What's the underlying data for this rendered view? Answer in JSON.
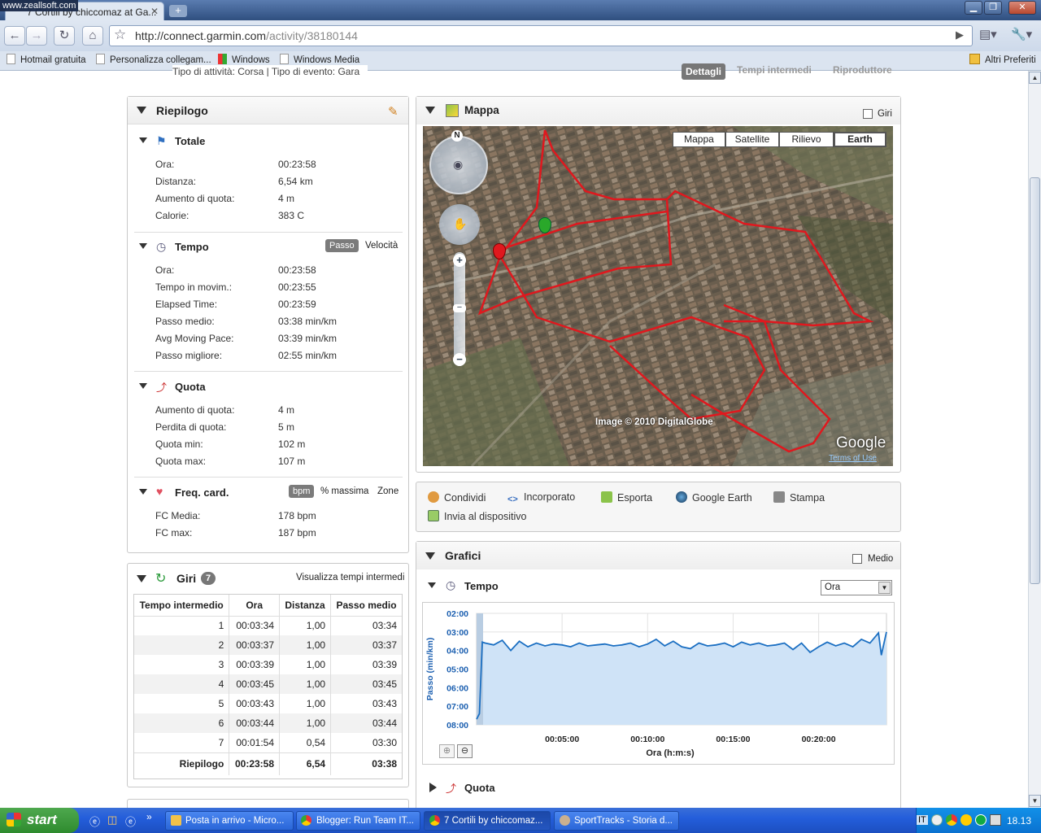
{
  "browser": {
    "watermark": "www.zeallsoft.com",
    "tab_title": "7 Cortili by chiccomaz at Ga...",
    "url_host": "http://connect.garmin.com",
    "url_path": "/activity/38180144",
    "bookmarks": [
      "Hotmail gratuita",
      "Personalizza collegam...",
      "Windows",
      "Windows Media"
    ],
    "other_bookmarks": "Altri Preferiti"
  },
  "page": {
    "top_info": "Tipo di attività: Corsa | Tipo di evento: Gara",
    "view_tabs": [
      "Dettagli",
      "Tempi intermedi",
      "Riproduttore"
    ]
  },
  "summary": {
    "title": "Riepilogo",
    "totale": {
      "title": "Totale",
      "rows": [
        {
          "label": "Ora:",
          "value": "00:23:58"
        },
        {
          "label": "Distanza:",
          "value": "6,54 km"
        },
        {
          "label": "Aumento di quota:",
          "value": "4 m"
        },
        {
          "label": "Calorie:",
          "value": "383 C"
        }
      ]
    },
    "tempo": {
      "title": "Tempo",
      "toggle": [
        "Passo",
        "Velocità"
      ],
      "rows": [
        {
          "label": "Ora:",
          "value": "00:23:58"
        },
        {
          "label": "Tempo in movim.:",
          "value": "00:23:55"
        },
        {
          "label": "Elapsed Time:",
          "value": "00:23:59"
        },
        {
          "label": "Passo medio:",
          "value": "03:38 min/km"
        },
        {
          "label": "Avg Moving Pace:",
          "value": "03:39 min/km"
        },
        {
          "label": "Passo migliore:",
          "value": "02:55 min/km"
        }
      ]
    },
    "quota": {
      "title": "Quota",
      "rows": [
        {
          "label": "Aumento di quota:",
          "value": "4 m"
        },
        {
          "label": "Perdita di quota:",
          "value": "5 m"
        },
        {
          "label": "Quota min:",
          "value": "102 m"
        },
        {
          "label": "Quota max:",
          "value": "107 m"
        }
      ]
    },
    "freq": {
      "title": "Freq. card.",
      "toggle": [
        "bpm",
        "% massima",
        "Zone"
      ],
      "rows": [
        {
          "label": "FC Media:",
          "value": "178 bpm"
        },
        {
          "label": "FC max:",
          "value": "187 bpm"
        }
      ]
    }
  },
  "laps": {
    "title": "Giri",
    "count": "7",
    "link": "Visualizza tempi intermedi",
    "columns": [
      "Tempo intermedio",
      "Ora",
      "Distanza",
      "Passo medio"
    ],
    "rows": [
      [
        "1",
        "00:03:34",
        "1,00",
        "03:34"
      ],
      [
        "2",
        "00:03:37",
        "1,00",
        "03:37"
      ],
      [
        "3",
        "00:03:39",
        "1,00",
        "03:39"
      ],
      [
        "4",
        "00:03:45",
        "1,00",
        "03:45"
      ],
      [
        "5",
        "00:03:43",
        "1,00",
        "03:43"
      ],
      [
        "6",
        "00:03:44",
        "1,00",
        "03:44"
      ],
      [
        "7",
        "00:01:54",
        "0,54",
        "03:30"
      ]
    ],
    "total": [
      "Riepilogo",
      "00:23:58",
      "6,54",
      "03:38"
    ]
  },
  "map": {
    "title": "Mappa",
    "laps_checkbox": "Giri",
    "types": [
      "Mappa",
      "Satellite",
      "Rilievo",
      "Earth"
    ],
    "compass": "N",
    "credit": "Image © 2010 DigitalGlobe",
    "brand": "Google",
    "terms": "Terms of Use"
  },
  "actions": [
    "Condividi",
    "Incorporato",
    "Esporta",
    "Google Earth",
    "Stampa",
    "Invia al dispositivo"
  ],
  "charts": {
    "title": "Grafici",
    "medio": "Medio",
    "tempo_title": "Tempo",
    "select_value": "Ora",
    "quota_title": "Quota"
  },
  "chart_data": {
    "type": "area",
    "title": "",
    "xlabel": "Ora (h:m:s)",
    "ylabel": "Passo (min/km)",
    "x_ticks": [
      "00:05:00",
      "00:10:00",
      "00:15:00",
      "00:20:00"
    ],
    "y_ticks": [
      "02:00",
      "03:00",
      "04:00",
      "05:00",
      "06:00",
      "07:00",
      "08:00"
    ],
    "ylim_min_per_km": [
      2,
      8
    ],
    "y_inverted": true,
    "x_seconds": [
      0,
      10,
      20,
      30,
      60,
      90,
      120,
      150,
      180,
      210,
      240,
      270,
      300,
      330,
      360,
      390,
      420,
      450,
      480,
      510,
      540,
      570,
      600,
      630,
      660,
      690,
      720,
      750,
      780,
      810,
      840,
      870,
      900,
      930,
      960,
      990,
      1020,
      1050,
      1080,
      1110,
      1140,
      1170,
      1200,
      1230,
      1260,
      1290,
      1320,
      1350,
      1380,
      1410,
      1420,
      1438
    ],
    "pace_min_per_km": [
      7.7,
      7.4,
      3.55,
      3.6,
      3.7,
      3.45,
      4.0,
      3.5,
      3.8,
      3.6,
      3.75,
      3.65,
      3.7,
      3.8,
      3.6,
      3.75,
      3.7,
      3.65,
      3.75,
      3.7,
      3.6,
      3.8,
      3.65,
      3.4,
      3.75,
      3.5,
      3.8,
      3.9,
      3.6,
      3.75,
      3.7,
      3.6,
      3.8,
      3.55,
      3.7,
      3.6,
      3.75,
      3.7,
      3.6,
      3.95,
      3.6,
      4.1,
      3.8,
      3.55,
      3.75,
      3.6,
      3.8,
      3.4,
      3.6,
      3.05,
      4.25,
      3.0
    ]
  },
  "taskbar": {
    "start": "start",
    "tasks": [
      "Posta in arrivo - Micro...",
      "Blogger: Run Team IT...",
      "7 Cortili by chiccomaz...",
      "SportTracks - Storia d..."
    ],
    "lang": "IT",
    "clock": "18.13"
  },
  "colors": {
    "route": "#e0181e",
    "chart_fill": "#cfe3f7",
    "chart_line": "#1b6fc2",
    "axis_text": "#1b5fb0"
  }
}
